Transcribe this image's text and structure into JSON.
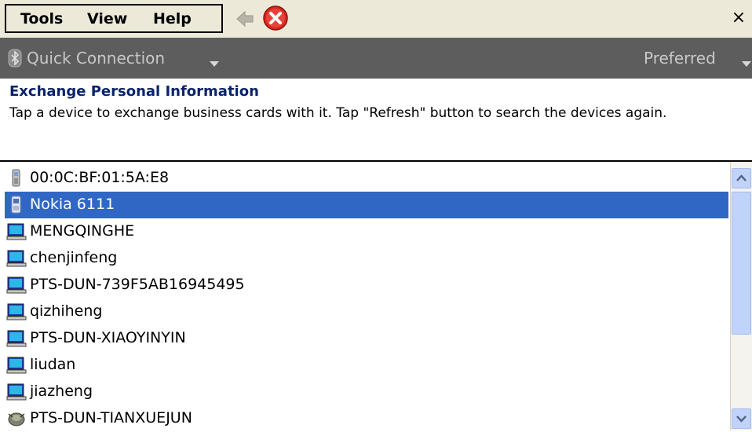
{
  "menu": {
    "tools": "Tools",
    "view": "View",
    "help": "Help"
  },
  "toolbar": {
    "back_icon": "back-arrow-icon",
    "stop_icon": "stop-icon",
    "close_label": "×"
  },
  "connection": {
    "label": "Quick Connection",
    "preferred": "Preferred"
  },
  "exchange": {
    "title": "Exchange Personal Information",
    "description": "Tap a device to exchange business cards with it. Tap \"Refresh\" button to search the devices again."
  },
  "devices": [
    {
      "name": "00:0C:BF:01:5A:E8",
      "icon": "phone-icon",
      "selected": false
    },
    {
      "name": "Nokia 6111",
      "icon": "phone-icon",
      "selected": true
    },
    {
      "name": "MENGQINGHE",
      "icon": "computer-icon",
      "selected": false
    },
    {
      "name": "chenjinfeng",
      "icon": "computer-icon",
      "selected": false
    },
    {
      "name": "PTS-DUN-739F5AB16945495",
      "icon": "computer-icon",
      "selected": false
    },
    {
      "name": "qizhiheng",
      "icon": "computer-icon",
      "selected": false
    },
    {
      "name": "PTS-DUN-XIAOYINYIN",
      "icon": "computer-icon",
      "selected": false
    },
    {
      "name": "liudan",
      "icon": "computer-icon",
      "selected": false
    },
    {
      "name": "jiazheng",
      "icon": "computer-icon",
      "selected": false
    },
    {
      "name": "PTS-DUN-TIANXUEJUN",
      "icon": "misc-device-icon",
      "selected": false
    }
  ],
  "colors": {
    "selection": "#3167c4",
    "title": "#0a246a",
    "connbar": "#5d5d5d",
    "toolbar": "#ece9d8"
  }
}
